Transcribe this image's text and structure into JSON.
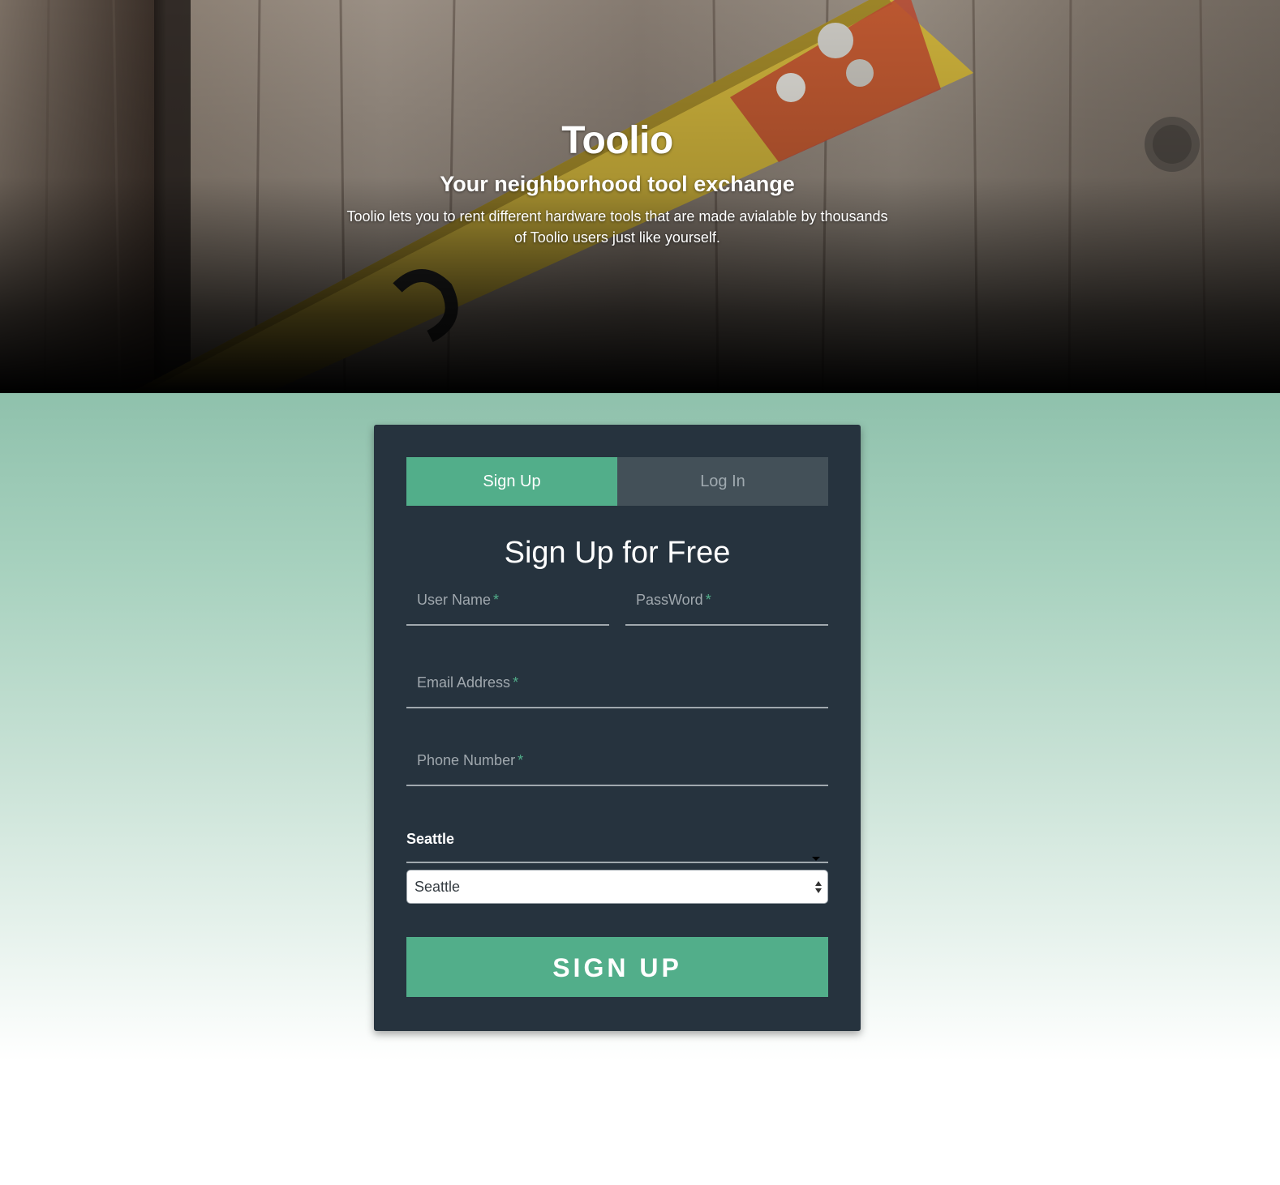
{
  "hero": {
    "title": "Toolio",
    "subtitle": "Your neighborhood tool exchange",
    "description": "Toolio lets you to rent different hardware tools that are made avialable by thousands of Toolio users just like yourself."
  },
  "tabs": [
    {
      "label": "Sign Up",
      "active": true
    },
    {
      "label": "Log In",
      "active": false
    }
  ],
  "form": {
    "title": "Sign Up for Free",
    "fields": {
      "username": {
        "label": "User Name",
        "required_mark": "*",
        "value": ""
      },
      "password": {
        "label": "PassWord",
        "required_mark": "*",
        "value": ""
      },
      "email": {
        "label": "Email Address",
        "required_mark": "*",
        "value": ""
      },
      "phone": {
        "label": "Phone Number",
        "required_mark": "*",
        "value": ""
      }
    },
    "city": {
      "label": "Seattle",
      "selected": "Seattle"
    },
    "submit_label": "SIGN UP"
  },
  "colors": {
    "accent": "#52ae8a",
    "card_bg": "#26333e",
    "inactive_tab": "#435058",
    "field_line": "#a0a8ae"
  }
}
